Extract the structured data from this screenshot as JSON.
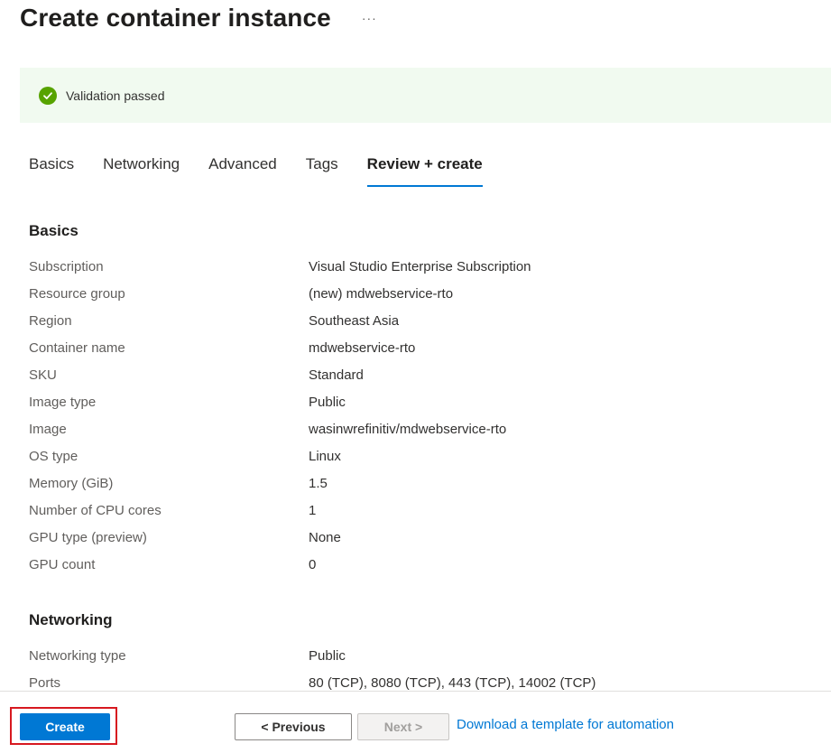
{
  "header": {
    "title": "Create container instance",
    "more_label": "···"
  },
  "validation": {
    "icon": "check-circle-icon",
    "text": "Validation passed",
    "color": "#57a300",
    "background": "#f1faf0"
  },
  "tabs": [
    {
      "label": "Basics",
      "active": false
    },
    {
      "label": "Networking",
      "active": false
    },
    {
      "label": "Advanced",
      "active": false
    },
    {
      "label": "Tags",
      "active": false
    },
    {
      "label": "Review + create",
      "active": true
    }
  ],
  "sections": {
    "basics": {
      "title": "Basics",
      "rows": [
        {
          "key": "Subscription",
          "value": "Visual Studio Enterprise Subscription"
        },
        {
          "key": "Resource group",
          "value": "(new) mdwebservice-rto"
        },
        {
          "key": "Region",
          "value": "Southeast Asia"
        },
        {
          "key": "Container name",
          "value": "mdwebservice-rto"
        },
        {
          "key": "SKU",
          "value": "Standard"
        },
        {
          "key": "Image type",
          "value": "Public"
        },
        {
          "key": "Image",
          "value": "wasinwrefinitiv/mdwebservice-rto"
        },
        {
          "key": "OS type",
          "value": "Linux"
        },
        {
          "key": "Memory (GiB)",
          "value": "1.5"
        },
        {
          "key": "Number of CPU cores",
          "value": "1"
        },
        {
          "key": "GPU type (preview)",
          "value": "None"
        },
        {
          "key": "GPU count",
          "value": "0"
        }
      ]
    },
    "networking": {
      "title": "Networking",
      "rows": [
        {
          "key": "Networking type",
          "value": "Public"
        },
        {
          "key": "Ports",
          "value": "80 (TCP), 8080 (TCP), 443 (TCP), 14002 (TCP)"
        }
      ]
    }
  },
  "footer": {
    "create_label": "Create",
    "previous_label": "< Previous",
    "next_label": "Next >",
    "download_link": "Download a template for automation"
  },
  "colors": {
    "accent": "#0078d4",
    "highlight": "#d71920"
  }
}
